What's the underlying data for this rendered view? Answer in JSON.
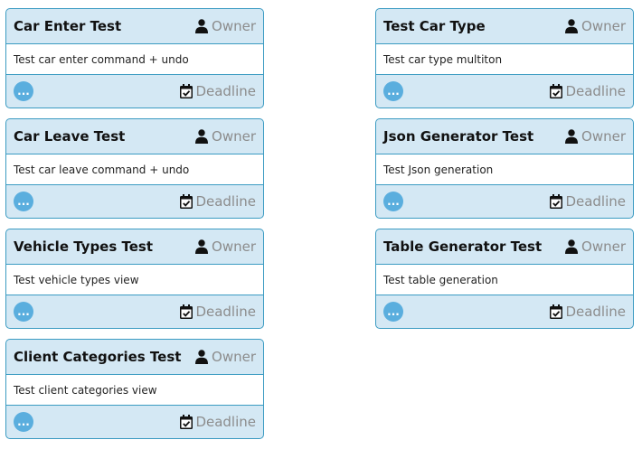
{
  "cards_left": [
    {
      "title": "Car Enter Test",
      "owner": "Owner",
      "description": "Test car enter command + undo",
      "more": "...",
      "deadline": "Deadline"
    },
    {
      "title": "Car Leave Test",
      "owner": "Owner",
      "description": "Test car leave command + undo",
      "more": "...",
      "deadline": "Deadline"
    },
    {
      "title": "Vehicle Types Test",
      "owner": "Owner",
      "description": "Test vehicle types view",
      "more": "...",
      "deadline": "Deadline"
    },
    {
      "title": "Client Categories Test",
      "owner": "Owner",
      "description": "Test client categories view",
      "more": "...",
      "deadline": "Deadline"
    }
  ],
  "cards_right": [
    {
      "title": "Test Car Type",
      "owner": "Owner",
      "description": "Test car type multiton",
      "more": "...",
      "deadline": "Deadline"
    },
    {
      "title": "Json Generator Test",
      "owner": "Owner",
      "description": "Test Json generation",
      "more": "...",
      "deadline": "Deadline"
    },
    {
      "title": "Table Generator Test",
      "owner": "Owner",
      "description": "Test table generation",
      "more": "...",
      "deadline": "Deadline"
    }
  ],
  "icons": {
    "owner": "user-icon",
    "deadline": "calendar-check-icon"
  },
  "colors": {
    "card_bg": "#d4e8f4",
    "border": "#3b9bc2",
    "button": "#5aaede",
    "muted_text": "#8c8c8c"
  }
}
